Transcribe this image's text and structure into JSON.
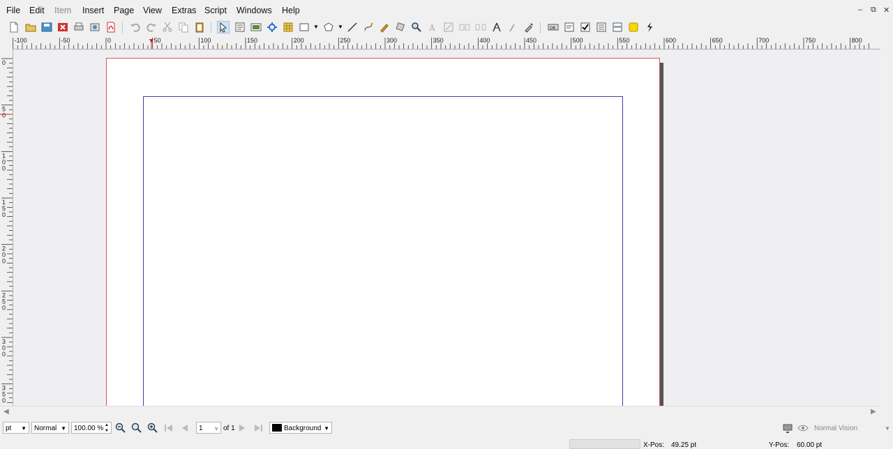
{
  "menu": {
    "items": [
      {
        "label": "File",
        "enabled": true
      },
      {
        "label": "Edit",
        "enabled": true
      },
      {
        "label": "Item",
        "enabled": false
      },
      {
        "label": "Insert",
        "enabled": true
      },
      {
        "label": "Page",
        "enabled": true
      },
      {
        "label": "View",
        "enabled": true
      },
      {
        "label": "Extras",
        "enabled": true
      },
      {
        "label": "Script",
        "enabled": true
      },
      {
        "label": "Windows",
        "enabled": true
      },
      {
        "label": "Help",
        "enabled": true
      }
    ]
  },
  "window_controls": {
    "minimize": "–",
    "restore": "⧉",
    "close": "✕"
  },
  "toolbar": {
    "icons": [
      "new-document-icon",
      "open-document-icon",
      "save-icon",
      "close-document-icon",
      "print-icon",
      "preflight-icon",
      "export-pdf-icon",
      "undo-icon",
      "redo-icon",
      "cut-icon",
      "copy-icon",
      "paste-icon",
      "select-icon",
      "text-frame-icon",
      "image-frame-icon",
      "render-frame-icon",
      "table-icon",
      "shape-icon",
      "polygon-icon",
      "line-icon",
      "bezier-icon",
      "freehand-icon",
      "rotate-icon",
      "zoom-icon",
      "edit-text-icon",
      "edit-contents-icon",
      "link-frames-icon",
      "unlink-frames-icon",
      "measure-icon",
      "copy-properties-icon",
      "eyedropper-icon",
      "pdf-button-icon",
      "pdf-text-field-icon",
      "pdf-checkbox-icon",
      "pdf-combo-box-icon",
      "pdf-list-box-icon",
      "pdf-annotation-icon",
      "pdf-link-icon"
    ]
  },
  "ruler": {
    "horizontal_labels": [
      "-100",
      "-50",
      "0",
      "50",
      "100",
      "150",
      "200",
      "250",
      "300",
      "350",
      "400",
      "450",
      "500",
      "550",
      "600",
      "650",
      "700",
      "750",
      "800"
    ],
    "vertical_labels": [
      "0",
      "50",
      "100",
      "150",
      "200",
      "250",
      "300",
      "350"
    ]
  },
  "statusbar": {
    "unit": "pt",
    "mode": "Normal",
    "zoom": "100.00 %",
    "page_number": "1",
    "page_of": "of 1",
    "layer": "Background",
    "vision": "Normal Vision",
    "x_pos_label": "X-Pos:",
    "x_pos_value": "49.25 pt",
    "y_pos_label": "Y-Pos:",
    "y_pos_value": "60.00 pt"
  },
  "colors": {
    "page_border": "#e05050",
    "margin_guide": "#4040a0",
    "layer_swatch": "#000000"
  }
}
